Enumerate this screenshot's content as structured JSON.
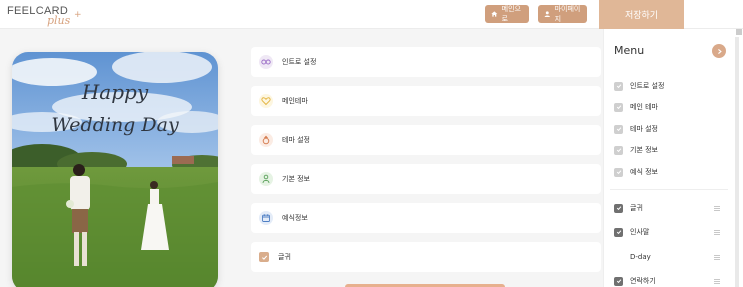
{
  "header": {
    "logo_main": "FEELCARD",
    "logo_sub": "plus",
    "logo_plus": "+",
    "main_button": "메인으로",
    "mypage_button": "마이페이지",
    "save_button": "저장하기"
  },
  "preview": {
    "title_line1": "Happy",
    "title_line2": "Wedding Day"
  },
  "cards": [
    {
      "label": "인트로 설정",
      "icon": "glasses-icon"
    },
    {
      "label": "메인테마",
      "icon": "heart-icon"
    },
    {
      "label": "테마 설정",
      "icon": "ring-icon"
    },
    {
      "label": "기본 정보",
      "icon": "couple-icon"
    },
    {
      "label": "예식정보",
      "icon": "calendar-icon"
    },
    {
      "label": "글귀",
      "icon": "checkbox-icon"
    }
  ],
  "sidebar": {
    "title": "Menu",
    "fixed_items": [
      "인트로 설정",
      "메인 테마",
      "테마 설정",
      "기본 정보",
      "예식 정보"
    ],
    "optional_items": [
      {
        "label": "글귀",
        "checked": true
      },
      {
        "label": "인사말",
        "checked": true
      },
      {
        "label": "D-day",
        "checked": false
      },
      {
        "label": "연락하기",
        "checked": true
      }
    ]
  },
  "colors": {
    "accent": "#d09f7d",
    "save": "#e0b797",
    "card_bg": "#ffffff",
    "page_bg": "#f5f5f5"
  }
}
